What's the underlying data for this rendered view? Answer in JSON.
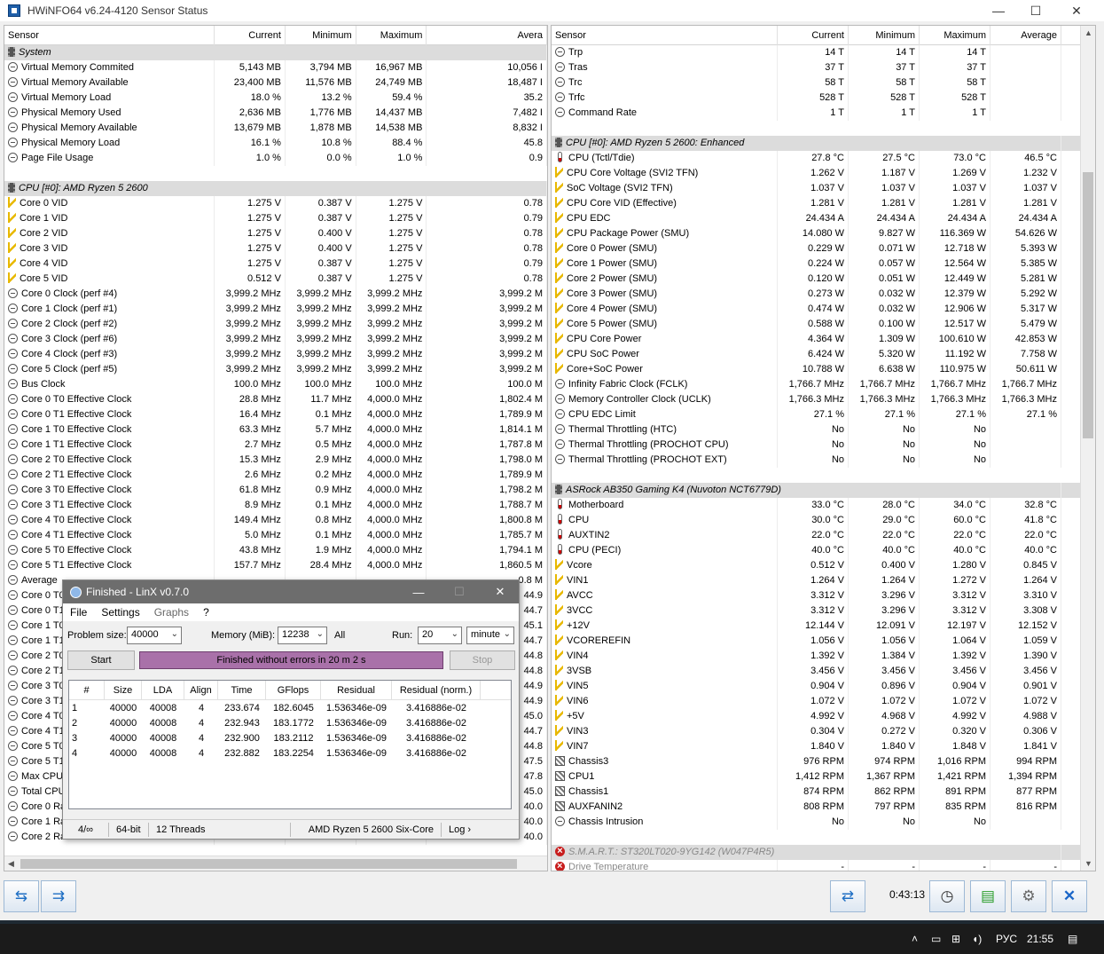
{
  "app": {
    "title": "HWiNFO64 v6.24-4120 Sensor Status"
  },
  "left_columns": [
    "Sensor",
    "Current",
    "Minimum",
    "Maximum",
    "Avera"
  ],
  "right_columns": [
    "Sensor",
    "Current",
    "Minimum",
    "Maximum",
    "Average"
  ],
  "left_rows": [
    {
      "g": "System"
    },
    {
      "i": "circle",
      "n": "Virtual Memory Commited",
      "v": [
        "5,143 MB",
        "3,794 MB",
        "16,967 MB",
        "10,056 I"
      ]
    },
    {
      "i": "circle",
      "n": "Virtual Memory Available",
      "v": [
        "23,400 MB",
        "11,576 MB",
        "24,749 MB",
        "18,487 I"
      ]
    },
    {
      "i": "circle",
      "n": "Virtual Memory Load",
      "v": [
        "18.0 %",
        "13.2 %",
        "59.4 %",
        "35.2"
      ]
    },
    {
      "i": "circle",
      "n": "Physical Memory Used",
      "v": [
        "2,636 MB",
        "1,776 MB",
        "14,437 MB",
        "7,482 I"
      ]
    },
    {
      "i": "circle",
      "n": "Physical Memory Available",
      "v": [
        "13,679 MB",
        "1,878 MB",
        "14,538 MB",
        "8,832 I"
      ]
    },
    {
      "i": "circle",
      "n": "Physical Memory Load",
      "v": [
        "16.1 %",
        "10.8 %",
        "88.4 %",
        "45.8"
      ]
    },
    {
      "i": "circle",
      "n": "Page File Usage",
      "v": [
        "1.0 %",
        "0.0 %",
        "1.0 %",
        "0.9"
      ]
    },
    {
      "b": 1
    },
    {
      "g": "CPU [#0]: AMD Ryzen 5 2600"
    },
    {
      "i": "bolt",
      "n": "Core 0 VID",
      "v": [
        "1.275 V",
        "0.387 V",
        "1.275 V",
        "0.78"
      ]
    },
    {
      "i": "bolt",
      "n": "Core 1 VID",
      "v": [
        "1.275 V",
        "0.387 V",
        "1.275 V",
        "0.79"
      ]
    },
    {
      "i": "bolt",
      "n": "Core 2 VID",
      "v": [
        "1.275 V",
        "0.400 V",
        "1.275 V",
        "0.78"
      ]
    },
    {
      "i": "bolt",
      "n": "Core 3 VID",
      "v": [
        "1.275 V",
        "0.400 V",
        "1.275 V",
        "0.78"
      ]
    },
    {
      "i": "bolt",
      "n": "Core 4 VID",
      "v": [
        "1.275 V",
        "0.387 V",
        "1.275 V",
        "0.79"
      ]
    },
    {
      "i": "bolt",
      "n": "Core 5 VID",
      "v": [
        "0.512 V",
        "0.387 V",
        "1.275 V",
        "0.78"
      ]
    },
    {
      "i": "circle",
      "n": "Core 0 Clock (perf #4)",
      "v": [
        "3,999.2 MHz",
        "3,999.2 MHz",
        "3,999.2 MHz",
        "3,999.2 M"
      ]
    },
    {
      "i": "circle",
      "n": "Core 1 Clock (perf #1)",
      "v": [
        "3,999.2 MHz",
        "3,999.2 MHz",
        "3,999.2 MHz",
        "3,999.2 M"
      ]
    },
    {
      "i": "circle",
      "n": "Core 2 Clock (perf #2)",
      "v": [
        "3,999.2 MHz",
        "3,999.2 MHz",
        "3,999.2 MHz",
        "3,999.2 M"
      ]
    },
    {
      "i": "circle",
      "n": "Core 3 Clock (perf #6)",
      "v": [
        "3,999.2 MHz",
        "3,999.2 MHz",
        "3,999.2 MHz",
        "3,999.2 M"
      ]
    },
    {
      "i": "circle",
      "n": "Core 4 Clock (perf #3)",
      "v": [
        "3,999.2 MHz",
        "3,999.2 MHz",
        "3,999.2 MHz",
        "3,999.2 M"
      ]
    },
    {
      "i": "circle",
      "n": "Core 5 Clock (perf #5)",
      "v": [
        "3,999.2 MHz",
        "3,999.2 MHz",
        "3,999.2 MHz",
        "3,999.2 M"
      ]
    },
    {
      "i": "circle",
      "n": "Bus Clock",
      "v": [
        "100.0 MHz",
        "100.0 MHz",
        "100.0 MHz",
        "100.0 M"
      ]
    },
    {
      "i": "circle",
      "n": "Core 0 T0 Effective Clock",
      "v": [
        "28.8 MHz",
        "11.7 MHz",
        "4,000.0 MHz",
        "1,802.4 M"
      ]
    },
    {
      "i": "circle",
      "n": "Core 0 T1 Effective Clock",
      "v": [
        "16.4 MHz",
        "0.1 MHz",
        "4,000.0 MHz",
        "1,789.9 M"
      ]
    },
    {
      "i": "circle",
      "n": "Core 1 T0 Effective Clock",
      "v": [
        "63.3 MHz",
        "5.7 MHz",
        "4,000.0 MHz",
        "1,814.1 M"
      ]
    },
    {
      "i": "circle",
      "n": "Core 1 T1 Effective Clock",
      "v": [
        "2.7 MHz",
        "0.5 MHz",
        "4,000.0 MHz",
        "1,787.8 M"
      ]
    },
    {
      "i": "circle",
      "n": "Core 2 T0 Effective Clock",
      "v": [
        "15.3 MHz",
        "2.9 MHz",
        "4,000.0 MHz",
        "1,798.0 M"
      ]
    },
    {
      "i": "circle",
      "n": "Core 2 T1 Effective Clock",
      "v": [
        "2.6 MHz",
        "0.2 MHz",
        "4,000.0 MHz",
        "1,789.9 M"
      ]
    },
    {
      "i": "circle",
      "n": "Core 3 T0 Effective Clock",
      "v": [
        "61.8 MHz",
        "0.9 MHz",
        "4,000.0 MHz",
        "1,798.2 M"
      ]
    },
    {
      "i": "circle",
      "n": "Core 3 T1 Effective Clock",
      "v": [
        "8.9 MHz",
        "0.1 MHz",
        "4,000.0 MHz",
        "1,788.7 M"
      ]
    },
    {
      "i": "circle",
      "n": "Core 4 T0 Effective Clock",
      "v": [
        "149.4 MHz",
        "0.8 MHz",
        "4,000.0 MHz",
        "1,800.8 M"
      ]
    },
    {
      "i": "circle",
      "n": "Core 4 T1 Effective Clock",
      "v": [
        "5.0 MHz",
        "0.1 MHz",
        "4,000.0 MHz",
        "1,785.7 M"
      ]
    },
    {
      "i": "circle",
      "n": "Core 5 T0 Effective Clock",
      "v": [
        "43.8 MHz",
        "1.9 MHz",
        "4,000.0 MHz",
        "1,794.1 M"
      ]
    },
    {
      "i": "circle",
      "n": "Core 5 T1 Effective Clock",
      "v": [
        "157.7 MHz",
        "28.4 MHz",
        "4,000.0 MHz",
        "1,860.5 M"
      ]
    },
    {
      "i": "circle",
      "n": "Average",
      "v": [
        "",
        "",
        "",
        "0.8 M"
      ]
    },
    {
      "i": "circle",
      "n": "Core 0 T0",
      "v": [
        "",
        "",
        "",
        "44.9"
      ]
    },
    {
      "i": "circle",
      "n": "Core 0 T1",
      "v": [
        "",
        "",
        "",
        "44.7"
      ]
    },
    {
      "i": "circle",
      "n": "Core 1 T0",
      "v": [
        "",
        "",
        "",
        "45.1"
      ]
    },
    {
      "i": "circle",
      "n": "Core 1 T1",
      "v": [
        "",
        "",
        "",
        "44.7"
      ]
    },
    {
      "i": "circle",
      "n": "Core 2 T0",
      "v": [
        "",
        "",
        "",
        "44.8"
      ]
    },
    {
      "i": "circle",
      "n": "Core 2 T1",
      "v": [
        "",
        "",
        "",
        "44.8"
      ]
    },
    {
      "i": "circle",
      "n": "Core 3 T0",
      "v": [
        "",
        "",
        "",
        "44.9"
      ]
    },
    {
      "i": "circle",
      "n": "Core 3 T1",
      "v": [
        "",
        "",
        "",
        "44.9"
      ]
    },
    {
      "i": "circle",
      "n": "Core 4 T0",
      "v": [
        "",
        "",
        "",
        "45.0"
      ]
    },
    {
      "i": "circle",
      "n": "Core 4 T1",
      "v": [
        "",
        "",
        "",
        "44.7"
      ]
    },
    {
      "i": "circle",
      "n": "Core 5 T0",
      "v": [
        "",
        "",
        "",
        "44.8"
      ]
    },
    {
      "i": "circle",
      "n": "Core 5 T1",
      "v": [
        "",
        "",
        "",
        "47.5"
      ]
    },
    {
      "i": "circle",
      "n": "Max CPU/",
      "v": [
        "",
        "",
        "",
        "47.8"
      ]
    },
    {
      "i": "circle",
      "n": "Total CPU",
      "v": [
        "",
        "",
        "",
        "45.0"
      ]
    },
    {
      "i": "circle",
      "n": "Core 0 Ra",
      "v": [
        "",
        "",
        "",
        "40.0"
      ]
    },
    {
      "i": "circle",
      "n": "Core 1 Ra",
      "v": [
        "",
        "",
        "",
        "40.0"
      ]
    },
    {
      "i": "circle",
      "n": "Core 2 Ratio",
      "v": [
        "",
        "",
        "",
        "40.0"
      ]
    }
  ],
  "right_rows": [
    {
      "i": "circle",
      "n": "Trp",
      "v": [
        "14 T",
        "14 T",
        "14 T",
        ""
      ]
    },
    {
      "i": "circle",
      "n": "Tras",
      "v": [
        "37 T",
        "37 T",
        "37 T",
        ""
      ]
    },
    {
      "i": "circle",
      "n": "Trc",
      "v": [
        "58 T",
        "58 T",
        "58 T",
        ""
      ]
    },
    {
      "i": "circle",
      "n": "Trfc",
      "v": [
        "528 T",
        "528 T",
        "528 T",
        ""
      ]
    },
    {
      "i": "circle",
      "n": "Command Rate",
      "v": [
        "1 T",
        "1 T",
        "1 T",
        ""
      ]
    },
    {
      "b": 1
    },
    {
      "g": "CPU [#0]: AMD Ryzen 5 2600: Enhanced"
    },
    {
      "i": "therm",
      "n": "CPU (Tctl/Tdie)",
      "v": [
        "27.8 °C",
        "27.5 °C",
        "73.0 °C",
        "46.5 °C"
      ]
    },
    {
      "i": "bolt",
      "n": "CPU Core Voltage (SVI2 TFN)",
      "v": [
        "1.262 V",
        "1.187 V",
        "1.269 V",
        "1.232 V"
      ]
    },
    {
      "i": "bolt",
      "n": "SoC Voltage (SVI2 TFN)",
      "v": [
        "1.037 V",
        "1.037 V",
        "1.037 V",
        "1.037 V"
      ]
    },
    {
      "i": "bolt",
      "n": "CPU Core VID (Effective)",
      "v": [
        "1.281 V",
        "1.281 V",
        "1.281 V",
        "1.281 V"
      ]
    },
    {
      "i": "bolt",
      "n": "CPU EDC",
      "v": [
        "24.434 A",
        "24.434 A",
        "24.434 A",
        "24.434 A"
      ]
    },
    {
      "i": "bolt",
      "n": "CPU Package Power (SMU)",
      "v": [
        "14.080 W",
        "9.827 W",
        "116.369 W",
        "54.626 W"
      ]
    },
    {
      "i": "bolt",
      "n": "Core 0 Power (SMU)",
      "v": [
        "0.229 W",
        "0.071 W",
        "12.718 W",
        "5.393 W"
      ]
    },
    {
      "i": "bolt",
      "n": "Core 1 Power (SMU)",
      "v": [
        "0.224 W",
        "0.057 W",
        "12.564 W",
        "5.385 W"
      ]
    },
    {
      "i": "bolt",
      "n": "Core 2 Power (SMU)",
      "v": [
        "0.120 W",
        "0.051 W",
        "12.449 W",
        "5.281 W"
      ]
    },
    {
      "i": "bolt",
      "n": "Core 3 Power (SMU)",
      "v": [
        "0.273 W",
        "0.032 W",
        "12.379 W",
        "5.292 W"
      ]
    },
    {
      "i": "bolt",
      "n": "Core 4 Power (SMU)",
      "v": [
        "0.474 W",
        "0.032 W",
        "12.906 W",
        "5.317 W"
      ]
    },
    {
      "i": "bolt",
      "n": "Core 5 Power (SMU)",
      "v": [
        "0.588 W",
        "0.100 W",
        "12.517 W",
        "5.479 W"
      ]
    },
    {
      "i": "bolt",
      "n": "CPU Core Power",
      "v": [
        "4.364 W",
        "1.309 W",
        "100.610 W",
        "42.853 W"
      ]
    },
    {
      "i": "bolt",
      "n": "CPU SoC Power",
      "v": [
        "6.424 W",
        "5.320 W",
        "11.192 W",
        "7.758 W"
      ]
    },
    {
      "i": "bolt",
      "n": "Core+SoC Power",
      "v": [
        "10.788 W",
        "6.638 W",
        "110.975 W",
        "50.611 W"
      ]
    },
    {
      "i": "circle",
      "n": "Infinity Fabric Clock (FCLK)",
      "v": [
        "1,766.7 MHz",
        "1,766.7 MHz",
        "1,766.7 MHz",
        "1,766.7 MHz"
      ]
    },
    {
      "i": "circle",
      "n": "Memory Controller Clock (UCLK)",
      "v": [
        "1,766.3 MHz",
        "1,766.3 MHz",
        "1,766.3 MHz",
        "1,766.3 MHz"
      ]
    },
    {
      "i": "circle",
      "n": "CPU EDC Limit",
      "v": [
        "27.1 %",
        "27.1 %",
        "27.1 %",
        "27.1 %"
      ]
    },
    {
      "i": "circle",
      "n": "Thermal Throttling (HTC)",
      "v": [
        "No",
        "No",
        "No",
        ""
      ]
    },
    {
      "i": "circle",
      "n": "Thermal Throttling (PROCHOT CPU)",
      "v": [
        "No",
        "No",
        "No",
        ""
      ]
    },
    {
      "i": "circle",
      "n": "Thermal Throttling (PROCHOT EXT)",
      "v": [
        "No",
        "No",
        "No",
        ""
      ]
    },
    {
      "b": 1
    },
    {
      "g": "ASRock AB350 Gaming K4 (Nuvoton NCT6779D)"
    },
    {
      "i": "therm",
      "n": "Motherboard",
      "v": [
        "33.0 °C",
        "28.0 °C",
        "34.0 °C",
        "32.8 °C"
      ]
    },
    {
      "i": "therm",
      "n": "CPU",
      "v": [
        "30.0 °C",
        "29.0 °C",
        "60.0 °C",
        "41.8 °C"
      ]
    },
    {
      "i": "therm",
      "n": "AUXTIN2",
      "v": [
        "22.0 °C",
        "22.0 °C",
        "22.0 °C",
        "22.0 °C"
      ]
    },
    {
      "i": "therm",
      "n": "CPU (PECI)",
      "v": [
        "40.0 °C",
        "40.0 °C",
        "40.0 °C",
        "40.0 °C"
      ]
    },
    {
      "i": "bolt",
      "n": "Vcore",
      "v": [
        "0.512 V",
        "0.400 V",
        "1.280 V",
        "0.845 V"
      ]
    },
    {
      "i": "bolt",
      "n": "VIN1",
      "v": [
        "1.264 V",
        "1.264 V",
        "1.272 V",
        "1.264 V"
      ]
    },
    {
      "i": "bolt",
      "n": "AVCC",
      "v": [
        "3.312 V",
        "3.296 V",
        "3.312 V",
        "3.310 V"
      ]
    },
    {
      "i": "bolt",
      "n": "3VCC",
      "v": [
        "3.312 V",
        "3.296 V",
        "3.312 V",
        "3.308 V"
      ]
    },
    {
      "i": "bolt",
      "n": "+12V",
      "v": [
        "12.144 V",
        "12.091 V",
        "12.197 V",
        "12.152 V"
      ]
    },
    {
      "i": "bolt",
      "n": "VCOREREFIN",
      "v": [
        "1.056 V",
        "1.056 V",
        "1.064 V",
        "1.059 V"
      ]
    },
    {
      "i": "bolt",
      "n": "VIN4",
      "v": [
        "1.392 V",
        "1.384 V",
        "1.392 V",
        "1.390 V"
      ]
    },
    {
      "i": "bolt",
      "n": "3VSB",
      "v": [
        "3.456 V",
        "3.456 V",
        "3.456 V",
        "3.456 V"
      ]
    },
    {
      "i": "bolt",
      "n": "VIN5",
      "v": [
        "0.904 V",
        "0.896 V",
        "0.904 V",
        "0.901 V"
      ]
    },
    {
      "i": "bolt",
      "n": "VIN6",
      "v": [
        "1.072 V",
        "1.072 V",
        "1.072 V",
        "1.072 V"
      ]
    },
    {
      "i": "bolt",
      "n": "+5V",
      "v": [
        "4.992 V",
        "4.968 V",
        "4.992 V",
        "4.988 V"
      ]
    },
    {
      "i": "bolt",
      "n": "VIN3",
      "v": [
        "0.304 V",
        "0.272 V",
        "0.320 V",
        "0.306 V"
      ]
    },
    {
      "i": "bolt",
      "n": "VIN7",
      "v": [
        "1.840 V",
        "1.840 V",
        "1.848 V",
        "1.841 V"
      ]
    },
    {
      "i": "fan",
      "n": "Chassis3",
      "v": [
        "976 RPM",
        "974 RPM",
        "1,016 RPM",
        "994 RPM"
      ]
    },
    {
      "i": "fan",
      "n": "CPU1",
      "v": [
        "1,412 RPM",
        "1,367 RPM",
        "1,421 RPM",
        "1,394 RPM"
      ]
    },
    {
      "i": "fan",
      "n": "Chassis1",
      "v": [
        "874 RPM",
        "862 RPM",
        "891 RPM",
        "877 RPM"
      ]
    },
    {
      "i": "fan",
      "n": "AUXFANIN2",
      "v": [
        "808 RPM",
        "797 RPM",
        "835 RPM",
        "816 RPM"
      ]
    },
    {
      "i": "circle",
      "n": "Chassis Intrusion",
      "v": [
        "No",
        "No",
        "No",
        ""
      ]
    },
    {
      "b": 1
    },
    {
      "g": "S.M.A.R.T.: ST320LT020-9YG142 (W047P4R5)",
      "x": 1
    },
    {
      "i": "x",
      "n": "Drive Temperature",
      "v": [
        "-",
        "-",
        "-",
        "-"
      ]
    }
  ],
  "bottombar": {
    "elapsed": "0:43:13"
  },
  "taskbar": {
    "lang": "РУС",
    "time": "21:55"
  },
  "linx": {
    "title": "Finished - LinX v0.7.0",
    "menu": [
      "File",
      "Settings",
      "Graphs",
      "?"
    ],
    "problem_size_label": "Problem size:",
    "problem_size": "40000",
    "memory_label": "Memory (MiB):",
    "memory": "12238",
    "all_label": "All",
    "run_label": "Run:",
    "run": "20",
    "run_unit": "minute",
    "start_label": "Start",
    "progress_text": "Finished without errors in 20 m 2 s",
    "stop_label": "Stop",
    "columns": [
      "#",
      "Size",
      "LDA",
      "Align",
      "Time",
      "GFlops",
      "Residual",
      "Residual (norm.)"
    ],
    "rows": [
      [
        "1",
        "40000",
        "40008",
        "4",
        "233.674",
        "182.6045",
        "1.536346e-09",
        "3.416886e-02"
      ],
      [
        "2",
        "40000",
        "40008",
        "4",
        "232.943",
        "183.1772",
        "1.536346e-09",
        "3.416886e-02"
      ],
      [
        "3",
        "40000",
        "40008",
        "4",
        "232.900",
        "183.2112",
        "1.536346e-09",
        "3.416886e-02"
      ],
      [
        "4",
        "40000",
        "40008",
        "4",
        "232.882",
        "183.2254",
        "1.536346e-09",
        "3.416886e-02"
      ]
    ],
    "status": [
      "4/∞",
      "64-bit",
      "12 Threads",
      "AMD Ryzen 5 2600 Six-Core",
      "Log ›"
    ]
  }
}
